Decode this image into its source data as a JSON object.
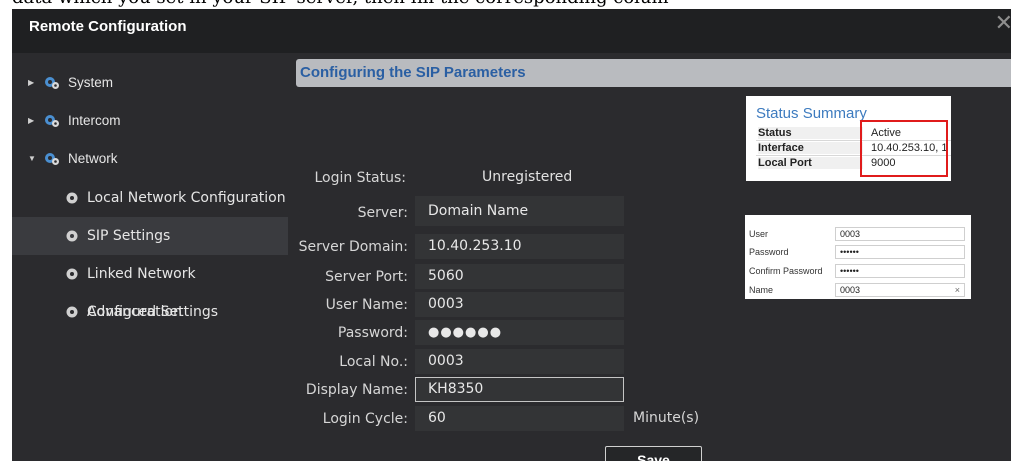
{
  "background_text": "data which you set in your SIP server, then fill the corresponding colum",
  "window": {
    "title": "Remote Configuration",
    "close_glyph": "✕"
  },
  "sidebar": {
    "items": [
      {
        "label": "System",
        "expanded": false,
        "icon": "gear-group-icon"
      },
      {
        "label": "Intercom",
        "expanded": false,
        "icon": "gear-group-icon"
      },
      {
        "label": "Network",
        "expanded": true,
        "icon": "gear-group-icon"
      }
    ],
    "subitems": [
      {
        "label": "Local Network Configuration",
        "icon": "gear-icon"
      },
      {
        "label": "SIP Settings",
        "icon": "gear-icon",
        "active": true
      },
      {
        "label": "Linked Network Configuration",
        "icon": "gear-icon"
      },
      {
        "label": "Advanced Settings",
        "icon": "gear-icon"
      }
    ]
  },
  "sip": {
    "section_title": "Configuring the SIP Parameters",
    "login_status_label": "Login Status:",
    "login_status_value": "Unregistered",
    "server_label": "Server:",
    "server_value": "Domain Name",
    "server_domain_label": "Server Domain:",
    "server_domain_value": "10.40.253.10",
    "server_port_label": "Server Port:",
    "server_port_value": "5060",
    "user_name_label": "User Name:",
    "user_name_value": "0003",
    "password_label": "Password:",
    "password_value": "●●●●●●",
    "local_no_label": "Local No.:",
    "local_no_value": "0003",
    "display_name_label": "Display Name:",
    "display_name_value": "KH8350",
    "login_cycle_label": "Login Cycle:",
    "login_cycle_value": "60",
    "login_cycle_unit": "Minute(s)",
    "save_label": "Save"
  },
  "status_summary": {
    "title": "Status Summary",
    "rows": [
      {
        "key": "Status",
        "value": "Active"
      },
      {
        "key": "Interface",
        "value": "10.40.253.10, 1"
      },
      {
        "key": "Local Port",
        "value": "9000"
      }
    ]
  },
  "user_form": {
    "user_label": "User",
    "user_value": "0003",
    "password_label": "Password",
    "password_value": "••••••",
    "confirm_label": "Confirm Password",
    "confirm_value": "••••••",
    "name_label": "Name",
    "name_value": "0003",
    "clear_glyph": "×"
  },
  "colors": {
    "window_bg": "#1f2022",
    "panel_bg": "#2b2b2e",
    "field_bg": "#333436",
    "header_bg": "#b9bbbf",
    "header_text": "#2a5fa3",
    "highlight_red": "#e01b1b"
  }
}
